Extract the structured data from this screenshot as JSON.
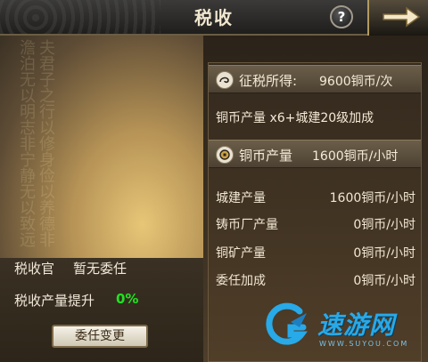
{
  "header": {
    "title": "税收",
    "help_label": "?"
  },
  "left": {
    "calligraphy": "夫君子之行以修身俭以养德非澹泊无以明志非宁静无以致远",
    "officer_label": "税收官",
    "officer_value": "暂无委任",
    "boost_label": "税收产量提升",
    "boost_value": "0%",
    "appoint_button": "委任变更"
  },
  "right": {
    "tax_label": "征税所得:",
    "tax_value": "9600铜币/次",
    "bonus_text": "铜币产量 x6+城建20级加成",
    "coin_label": "铜币产量",
    "coin_value": "1600铜币/小时",
    "stats": [
      {
        "label": "城建产量",
        "value": "1600铜币/小时"
      },
      {
        "label": "铸币厂产量",
        "value": "0铜币/小时"
      },
      {
        "label": "铜矿产量",
        "value": "0铜币/小时"
      },
      {
        "label": "委任加成",
        "value": "0铜币/小时"
      }
    ]
  },
  "watermark": {
    "text": "速游网",
    "sub": "WWW.SUYOU.COM"
  },
  "colors": {
    "accent_green": "#22e122",
    "text_light": "#f4ead6",
    "watermark_blue": "#28a9e8"
  }
}
